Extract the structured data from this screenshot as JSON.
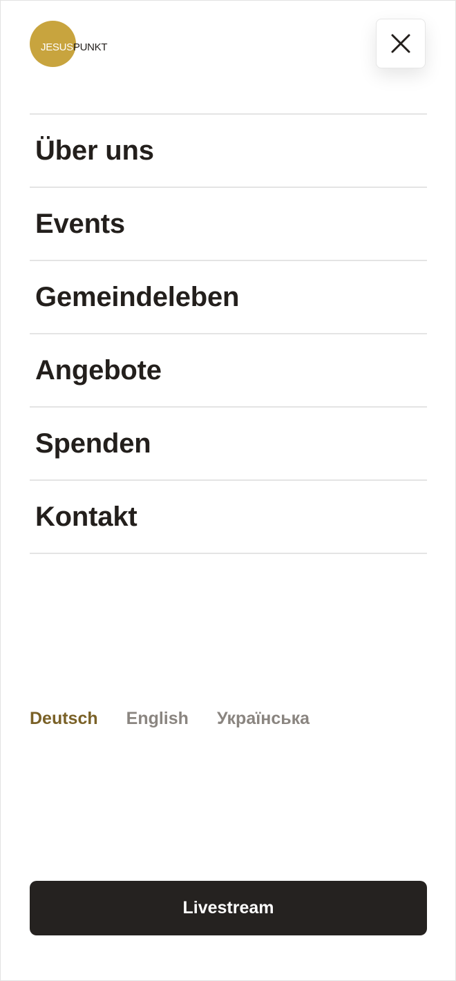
{
  "header": {
    "logo": {
      "word_1": "JESUS",
      "word_2": "PUNKT",
      "circle_color": "#c8a43e"
    },
    "close_icon": "close-icon"
  },
  "nav": {
    "items": [
      {
        "label": "Über uns"
      },
      {
        "label": "Events"
      },
      {
        "label": "Gemeindeleben"
      },
      {
        "label": "Angebote"
      },
      {
        "label": "Spenden"
      },
      {
        "label": "Kontakt"
      }
    ]
  },
  "languages": {
    "items": [
      {
        "label": "Deutsch",
        "active": true
      },
      {
        "label": "English",
        "active": false
      },
      {
        "label": "Українська",
        "active": false
      }
    ],
    "active_color": "#7a6127",
    "inactive_color": "#8a8580"
  },
  "livestream": {
    "label": "Livestream",
    "background": "#252220"
  }
}
